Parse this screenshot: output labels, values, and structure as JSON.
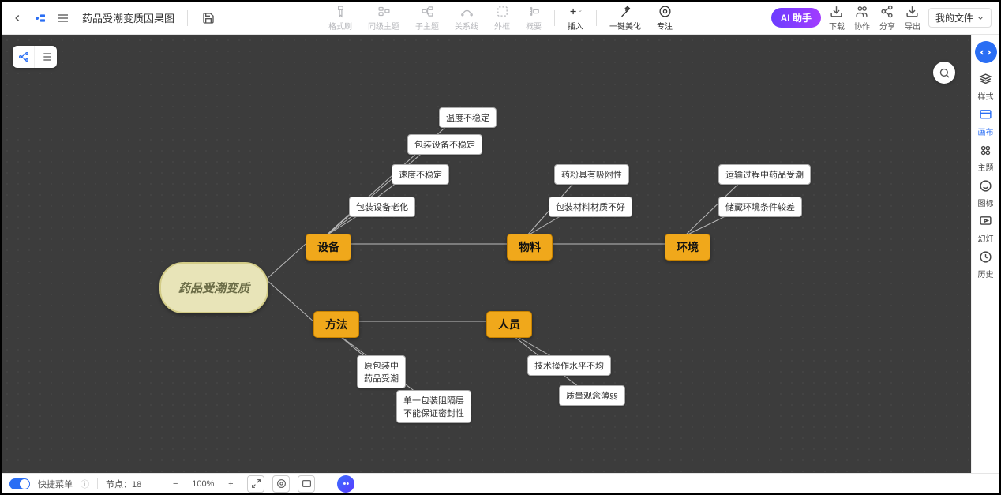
{
  "header": {
    "title": "药品受潮变质因果图",
    "tools_center": [
      {
        "id": "format",
        "label": "格式刷"
      },
      {
        "id": "peer",
        "label": "同级主题"
      },
      {
        "id": "child",
        "label": "子主题"
      },
      {
        "id": "relation",
        "label": "关系线"
      },
      {
        "id": "frame",
        "label": "外框"
      },
      {
        "id": "summary",
        "label": "概要"
      },
      {
        "id": "insert",
        "label": "插入",
        "active": true,
        "dropdown": true
      },
      {
        "id": "beautify",
        "label": "一键美化",
        "active": true
      },
      {
        "id": "focus",
        "label": "专注",
        "active": true
      }
    ],
    "ai_label": "AI 助手",
    "tools_right": [
      {
        "id": "download",
        "label": "下载"
      },
      {
        "id": "collab",
        "label": "协作"
      },
      {
        "id": "share",
        "label": "分享"
      },
      {
        "id": "export",
        "label": "导出"
      }
    ],
    "myfiles": "我的文件"
  },
  "rail": [
    {
      "id": "style",
      "label": "样式"
    },
    {
      "id": "canvas",
      "label": "画布",
      "selected": true
    },
    {
      "id": "theme",
      "label": "主题"
    },
    {
      "id": "icon",
      "label": "图标"
    },
    {
      "id": "slide",
      "label": "幻灯"
    },
    {
      "id": "history",
      "label": "历史"
    }
  ],
  "bottom": {
    "quick_menu": "快捷菜单",
    "node_count_label": "节点：",
    "node_count": 18,
    "zoom": "100%"
  },
  "diagram": {
    "root": "药品受潮变质",
    "branches": [
      {
        "name": "设备",
        "leaves": [
          "温度不稳定",
          "包装设备不稳定",
          "速度不稳定",
          "包装设备老化"
        ]
      },
      {
        "name": "物料",
        "leaves": [
          "药粉具有吸附性",
          "包装材料材质不好"
        ]
      },
      {
        "name": "环境",
        "leaves": [
          "运输过程中药品受潮",
          "储藏环境条件较差"
        ]
      },
      {
        "name": "方法",
        "leaves": [
          "原包装中\n药品受潮",
          "单一包装阻隔层\n不能保证密封性"
        ]
      },
      {
        "name": "人员",
        "leaves": [
          "技术操作水平不均",
          "质量观念薄弱"
        ]
      }
    ]
  }
}
